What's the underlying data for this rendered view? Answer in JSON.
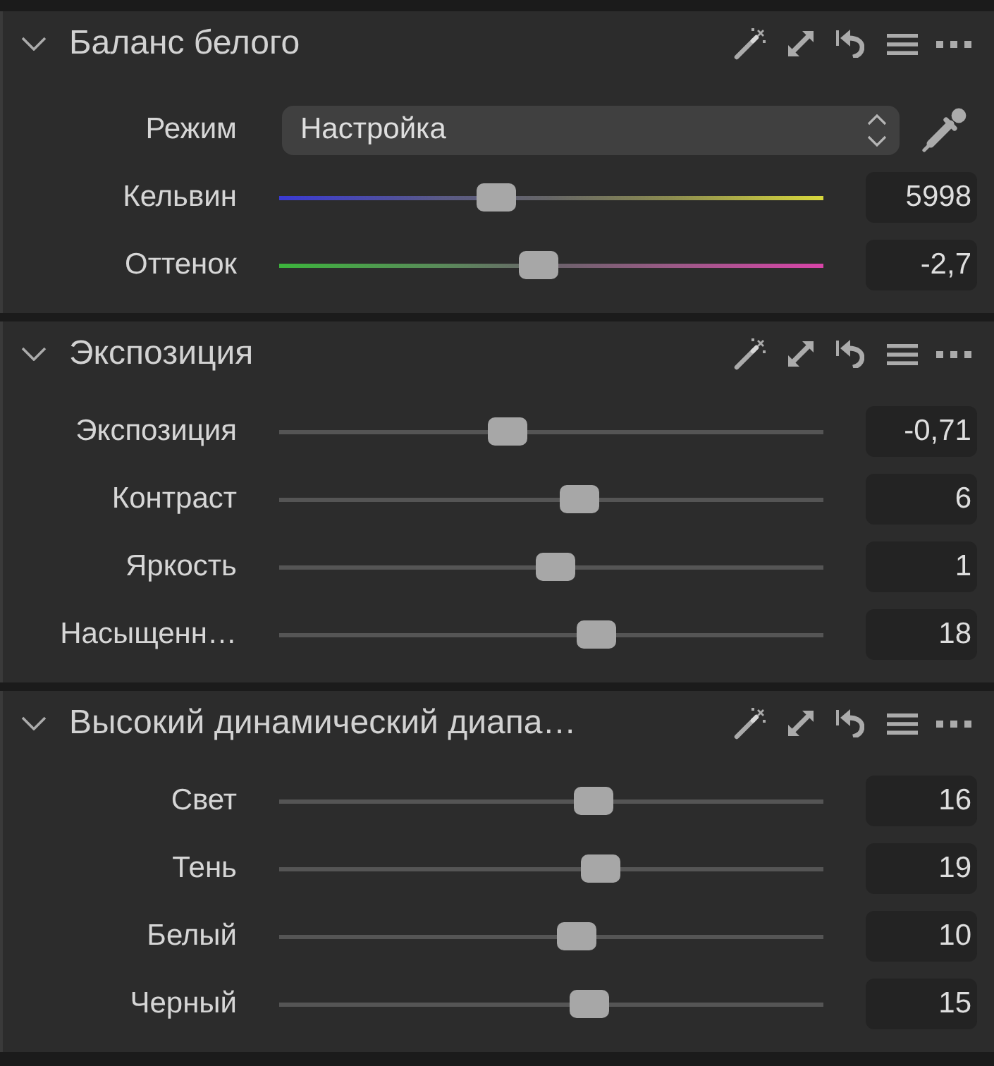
{
  "panels": [
    {
      "title": "Баланс белого",
      "expanded": true,
      "rows": [
        {
          "kind": "select",
          "label": "Режим",
          "value": "Настройка"
        },
        {
          "kind": "temperature-slider",
          "label": "Кельвин",
          "level": 0.4,
          "value": "5998"
        },
        {
          "kind": "tint-slider",
          "label": "Оттенок",
          "level": 0.477,
          "value": "-2,7"
        }
      ]
    },
    {
      "title": "Экспозиция",
      "expanded": true,
      "rows": [
        {
          "kind": "slider",
          "label": "Экспозиция",
          "level": 0.42,
          "value": "-0,71"
        },
        {
          "kind": "slider",
          "label": "Контраст",
          "level": 0.552,
          "value": "6"
        },
        {
          "kind": "slider",
          "label": "Яркость",
          "level": 0.508,
          "value": "1"
        },
        {
          "kind": "slider",
          "label": "Насыщенн…",
          "level": 0.583,
          "value": "18"
        }
      ]
    },
    {
      "title": "Высокий динамический диапа…",
      "expanded": true,
      "rows": [
        {
          "kind": "slider",
          "label": "Свет",
          "level": 0.578,
          "value": "16"
        },
        {
          "kind": "slider",
          "label": "Тень",
          "level": 0.59,
          "value": "19"
        },
        {
          "kind": "slider",
          "label": "Белый",
          "level": 0.547,
          "value": "10"
        },
        {
          "kind": "slider",
          "label": "Черный",
          "level": 0.57,
          "value": "15"
        }
      ]
    }
  ]
}
